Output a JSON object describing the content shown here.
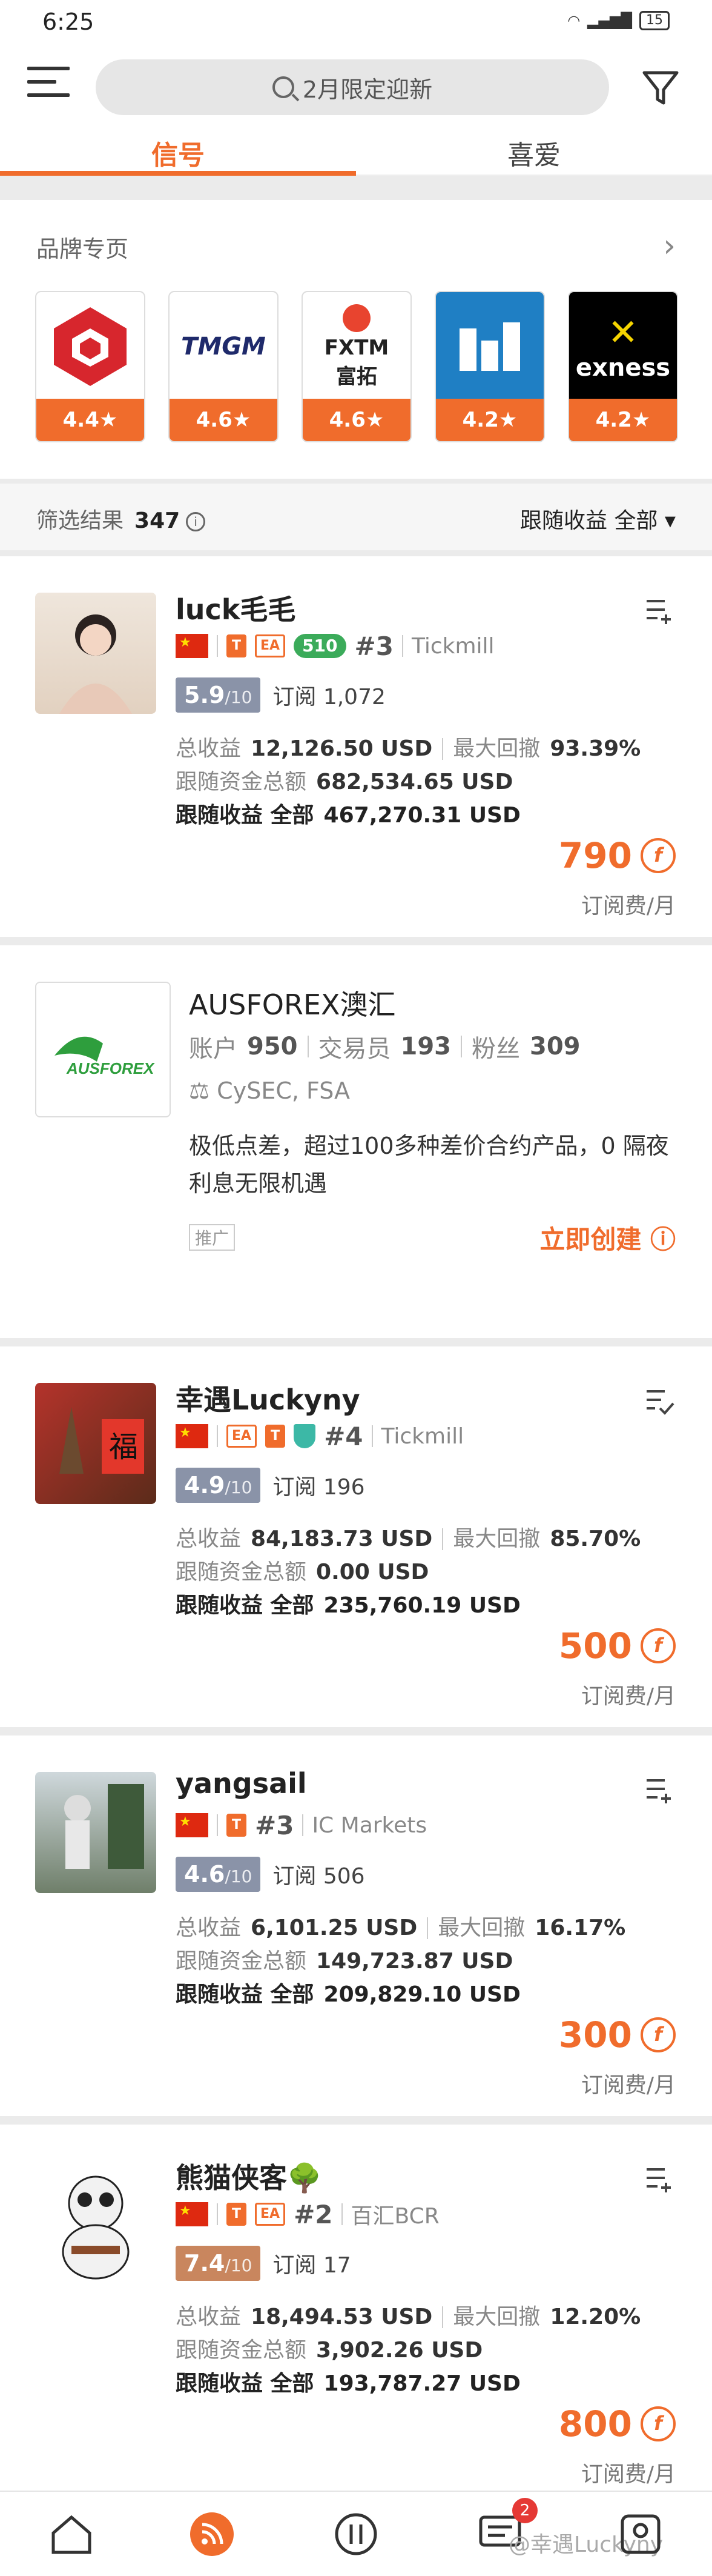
{
  "status_bar": {
    "time": "6:25",
    "battery": "15"
  },
  "header": {
    "search_placeholder": "2月限定迎新",
    "tabs": [
      {
        "label": "信号",
        "active": true
      },
      {
        "label": "喜爱",
        "active": false
      }
    ]
  },
  "brands": {
    "title": "品牌专页",
    "items": [
      {
        "name": "",
        "rating": "4.4★"
      },
      {
        "name": "TMGM",
        "rating": "4.6★"
      },
      {
        "name": "FXTM 富拓",
        "rating": "4.6★"
      },
      {
        "name": "",
        "rating": "4.2★"
      },
      {
        "name": "exness",
        "rating": "4.2★"
      }
    ]
  },
  "results": {
    "label": "筛选结果",
    "count": "347",
    "sort": "跟随收益 全部"
  },
  "signals": [
    {
      "name": "luck毛毛",
      "rank": "#3",
      "broker": "Tickmill",
      "level": "510",
      "score": "5.9",
      "score_max": "/10",
      "subs": "订阅 1,072",
      "total_profit_label": "总收益",
      "total_profit": "12,126.50 USD",
      "drawdown_label": "最大回撤",
      "drawdown": "93.39%",
      "funds_label": "跟随资金总额",
      "funds": "682,534.65 USD",
      "follow_label": "跟随收益 全部",
      "follow": "467,270.31 USD",
      "price": "790",
      "price_unit": "订阅费/月"
    },
    {
      "name": "幸遇Luckyny",
      "rank": "#4",
      "broker": "Tickmill",
      "score": "4.9",
      "score_max": "/10",
      "subs": "订阅 196",
      "total_profit_label": "总收益",
      "total_profit": "84,183.73 USD",
      "drawdown_label": "最大回撤",
      "drawdown": "85.70%",
      "funds_label": "跟随资金总额",
      "funds": "0.00 USD",
      "follow_label": "跟随收益 全部",
      "follow": "235,760.19 USD",
      "price": "500",
      "price_unit": "订阅费/月"
    },
    {
      "name": "yangsail",
      "rank": "#3",
      "broker": "IC Markets",
      "score": "4.6",
      "score_max": "/10",
      "subs": "订阅 506",
      "total_profit_label": "总收益",
      "total_profit": "6,101.25 USD",
      "drawdown_label": "最大回撤",
      "drawdown": "16.17%",
      "funds_label": "跟随资金总额",
      "funds": "149,723.87 USD",
      "follow_label": "跟随收益 全部",
      "follow": "209,829.10 USD",
      "price": "300",
      "price_unit": "订阅费/月"
    },
    {
      "name": "熊猫侠客🌳",
      "rank": "#2",
      "broker": "百汇BCR",
      "score": "7.4",
      "score_max": "/10",
      "subs": "订阅 17",
      "total_profit_label": "总收益",
      "total_profit": "18,494.53 USD",
      "drawdown_label": "最大回撤",
      "drawdown": "12.20%",
      "funds_label": "跟随资金总额",
      "funds": "3,902.26 USD",
      "follow_label": "跟随收益 全部",
      "follow": "193,787.27 USD",
      "price": "800",
      "price_unit": "订阅费/月"
    }
  ],
  "ad": {
    "title": "AUSFOREX澳汇",
    "accounts_label": "账户",
    "accounts": "950",
    "traders_label": "交易员",
    "traders": "193",
    "fans_label": "粉丝",
    "fans": "309",
    "regulators": "CySEC, FSA",
    "description": "极低点差，超过100多种差价合约产品，0 隔夜利息无限机遇",
    "promo": "推广",
    "cta": "立即创建"
  },
  "nav": {
    "chat_badge": "2",
    "watermark": "@幸遇Luckyny"
  },
  "colors": {
    "accent": "#f06c2c",
    "score_box": "#8a93a8"
  }
}
